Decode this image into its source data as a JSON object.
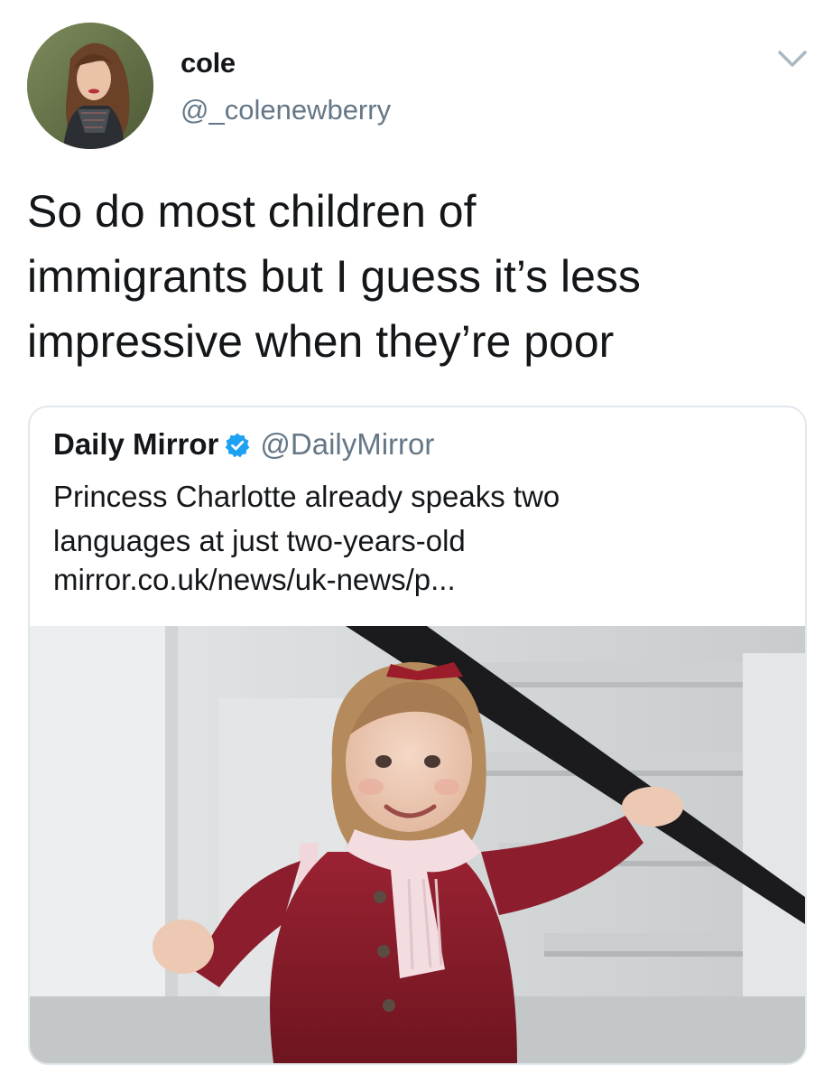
{
  "tweet": {
    "display_name": "cole",
    "handle": "@_colenewberry",
    "text_lines": [
      "So do most children of",
      "immigrants but I guess it’s less",
      "impressive when they’re poor"
    ]
  },
  "quoted": {
    "name": "Daily Mirror",
    "handle": "@DailyMirror",
    "text_lines": [
      "Princess Charlotte already speaks two",
      "languages at just two-years-old"
    ],
    "link": "mirror.co.uk/news/uk-news/p..."
  },
  "icons": {
    "menu": "chevron-down-icon",
    "verified": "verified-badge-icon"
  },
  "colors": {
    "text": "#14171a",
    "secondary": "#657786",
    "verified": "#1da1f2",
    "border": "#e1e8ed",
    "coat": "#8a1e2b"
  }
}
